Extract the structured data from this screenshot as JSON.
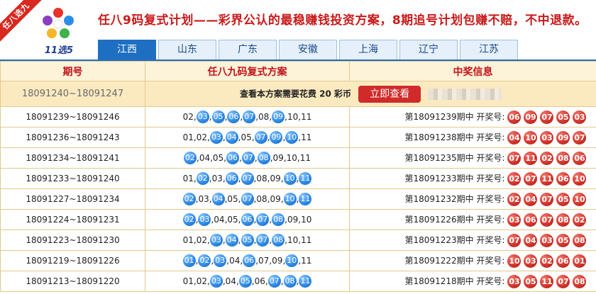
{
  "header": {
    "ribbon": "任八选九",
    "logo_caption": "11选5",
    "headline": "任八9码复式计划——彩界公认的最稳赚钱投资方案，8期追号计划包赚不赔，不中退款。"
  },
  "tabs": [
    {
      "label": "江西",
      "active": true
    },
    {
      "label": "山东",
      "active": false
    },
    {
      "label": "广东",
      "active": false
    },
    {
      "label": "安徽",
      "active": false
    },
    {
      "label": "上海",
      "active": false
    },
    {
      "label": "辽宁",
      "active": false
    },
    {
      "label": "江苏",
      "active": false
    }
  ],
  "table": {
    "headers": [
      "期号",
      "任八九码复式方案",
      "中奖信息"
    ],
    "promo": {
      "range": "18091240~18091247",
      "text_prefix": "查看本方案需要花费",
      "cost": "20",
      "text_suffix": "彩币",
      "button": "立即查看"
    },
    "rows": [
      {
        "period": "18091239~18091246",
        "codes": [
          [
            "02",
            false
          ],
          [
            "03",
            true
          ],
          [
            "05",
            true
          ],
          [
            "06",
            true
          ],
          [
            "07",
            true
          ],
          [
            "08",
            false
          ],
          [
            "09",
            true
          ],
          [
            "10",
            false
          ],
          [
            "11",
            false
          ]
        ],
        "result_prefix": "第18091239期中 开奖号:",
        "draw": [
          "06",
          "09",
          "07",
          "05",
          "03"
        ]
      },
      {
        "period": "18091236~18091243",
        "codes": [
          [
            "01",
            false
          ],
          [
            "02",
            false
          ],
          [
            "03",
            true
          ],
          [
            "04",
            true
          ],
          [
            "05",
            false
          ],
          [
            "07",
            true
          ],
          [
            "09",
            true
          ],
          [
            "10",
            true
          ],
          [
            "11",
            false
          ]
        ],
        "result_prefix": "第18091238期中 开奖号:",
        "draw": [
          "04",
          "10",
          "03",
          "09",
          "07"
        ]
      },
      {
        "period": "18091234~18091241",
        "codes": [
          [
            "02",
            true
          ],
          [
            "04",
            false
          ],
          [
            "05",
            false
          ],
          [
            "06",
            true
          ],
          [
            "07",
            true
          ],
          [
            "08",
            true
          ],
          [
            "09",
            false
          ],
          [
            "10",
            false
          ],
          [
            "11",
            false
          ]
        ],
        "result_prefix": "第18091235期中 开奖号:",
        "draw": [
          "07",
          "11",
          "02",
          "08",
          "06"
        ]
      },
      {
        "period": "18091233~18091240",
        "codes": [
          [
            "01",
            false
          ],
          [
            "02",
            true
          ],
          [
            "03",
            false
          ],
          [
            "06",
            true
          ],
          [
            "07",
            true
          ],
          [
            "08",
            false
          ],
          [
            "09",
            false
          ],
          [
            "10",
            true
          ],
          [
            "11",
            true
          ]
        ],
        "result_prefix": "第18091233期中 开奖号:",
        "draw": [
          "02",
          "07",
          "11",
          "06",
          "10"
        ]
      },
      {
        "period": "18091227~18091234",
        "codes": [
          [
            "02",
            true
          ],
          [
            "03",
            false
          ],
          [
            "04",
            true
          ],
          [
            "05",
            false
          ],
          [
            "07",
            true
          ],
          [
            "08",
            false
          ],
          [
            "09",
            false
          ],
          [
            "10",
            true
          ],
          [
            "11",
            true
          ]
        ],
        "result_prefix": "第18091232期中 开奖号:",
        "draw": [
          "02",
          "04",
          "07",
          "05",
          "10"
        ]
      },
      {
        "period": "18091224~18091231",
        "codes": [
          [
            "02",
            true
          ],
          [
            "03",
            true
          ],
          [
            "04",
            false
          ],
          [
            "05",
            false
          ],
          [
            "06",
            true
          ],
          [
            "07",
            true
          ],
          [
            "08",
            true
          ],
          [
            "09",
            false
          ],
          [
            "10",
            false
          ]
        ],
        "result_prefix": "第18091226期中 开奖号:",
        "draw": [
          "03",
          "06",
          "07",
          "08",
          "02"
        ]
      },
      {
        "period": "18091223~18091230",
        "codes": [
          [
            "01",
            false
          ],
          [
            "02",
            false
          ],
          [
            "03",
            true
          ],
          [
            "04",
            true
          ],
          [
            "05",
            true
          ],
          [
            "07",
            true
          ],
          [
            "08",
            true
          ],
          [
            "10",
            false
          ],
          [
            "11",
            false
          ]
        ],
        "result_prefix": "第18091223期中 开奖号:",
        "draw": [
          "07",
          "04",
          "03",
          "05",
          "08"
        ]
      },
      {
        "period": "18091219~18091226",
        "codes": [
          [
            "01",
            true
          ],
          [
            "02",
            true
          ],
          [
            "03",
            true
          ],
          [
            "04",
            false
          ],
          [
            "06",
            true
          ],
          [
            "07",
            false
          ],
          [
            "09",
            false
          ],
          [
            "10",
            true
          ],
          [
            "11",
            false
          ]
        ],
        "result_prefix": "第18091222期中 开奖号:",
        "draw": [
          "10",
          "03",
          "02",
          "06",
          "01"
        ]
      },
      {
        "period": "18091213~18091220",
        "codes": [
          [
            "01",
            false
          ],
          [
            "02",
            false
          ],
          [
            "03",
            true
          ],
          [
            "04",
            false
          ],
          [
            "05",
            true
          ],
          [
            "06",
            false
          ],
          [
            "07",
            true
          ],
          [
            "08",
            true
          ],
          [
            "11",
            true
          ]
        ],
        "result_prefix": "第18091218期中 开奖号:",
        "draw": [
          "03",
          "05",
          "11",
          "07",
          "08"
        ]
      }
    ]
  },
  "colors": {
    "accent": "#1e6fc2",
    "headline": "#c91a1a",
    "header_bg": "#fdf3d8",
    "promo_bg": "#fbeac0",
    "ball_blue": "#2f8be6",
    "ball_red": "#d4352c"
  },
  "icons": {
    "logo": "pinwheel-logo-icon"
  }
}
